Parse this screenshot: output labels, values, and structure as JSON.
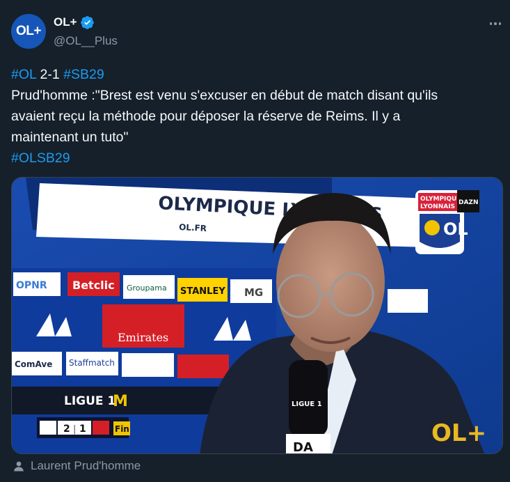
{
  "author": {
    "avatar_text": "OL+",
    "display_name": "OL+",
    "handle": "@OL__Plus",
    "verified": true
  },
  "tweet": {
    "line1_tag_a": "#OL",
    "line1_score": " 2-1 ",
    "line1_tag_b": "#SB29",
    "line2": "Prud'homme :\"Brest est venu s'excuser en début de match disant qu'ils",
    "line3": "avaient reçu la méthode pour déposer la réserve de Reims. Il y a",
    "line4": "maintenant un tuto\"",
    "line5_tag": "#OLSB29"
  },
  "media": {
    "banner_top": "OLYMPIQUE LYONNAIS",
    "banner_url": "OL.FR",
    "crest_top": "OLYMPIQUE",
    "crest_mid": "LYONNAIS",
    "dazn": "DAZN",
    "sponsors": {
      "opnr": "OPNR",
      "betclic": "Betclic",
      "groupama": "Groupama",
      "stanley": "STANLEY",
      "mg": "MG",
      "comave": "ComAve",
      "emirates": "Emirates",
      "staffmatch": "Staffmatch",
      "ligue1": "LIGUE 1"
    },
    "scoreboard": {
      "home_score": "2",
      "away_score": "1",
      "status": "Fin"
    },
    "mic_label": "LIGUE 1",
    "watermark": "OL+"
  },
  "caption": "Laurent Prud'homme",
  "colors": {
    "background": "#15202b",
    "link": "#1d9bf0",
    "muted": "#8b98a5",
    "avatar": "#1656b8"
  }
}
